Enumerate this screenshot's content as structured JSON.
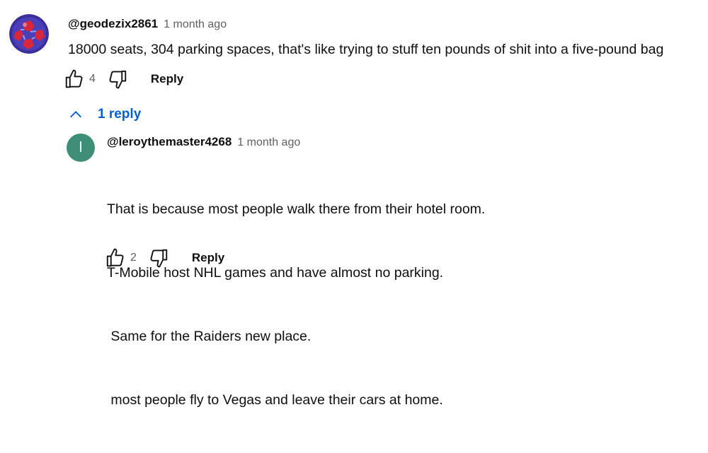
{
  "comment": {
    "author": "@geodezix2861",
    "timestamp": "1 month ago",
    "text": "18000 seats, 304 parking spaces, that's like trying to stuff ten pounds of shit into a five-pound bag",
    "like_count": "4",
    "reply_label": "Reply",
    "icons": {
      "avatar": "soccer-ball-avatar",
      "like": "thumbs-up-icon",
      "dislike": "thumbs-down-icon"
    }
  },
  "replies_toggle": {
    "label": "1 reply",
    "icon": "chevron-up-icon",
    "color": "#065fd4"
  },
  "reply": {
    "author": "@leroythemaster4268",
    "timestamp": "1 month ago",
    "avatar_letter": "l",
    "avatar_color": "#3f8f76",
    "lines": [
      "That is because most people walk there from their hotel room.",
      "T-Mobile host NHL games and have almost no parking.",
      " Same for the Raiders new place.",
      " most people fly to Vegas and leave their cars at home."
    ],
    "like_count": "2",
    "reply_label": "Reply"
  }
}
